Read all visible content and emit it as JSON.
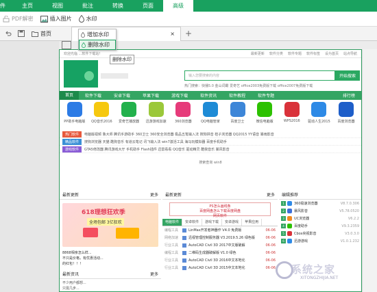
{
  "ribbon": {
    "left_label": "件",
    "tabs": [
      "主页",
      "视图",
      "批注",
      "转换",
      "页面",
      "高级"
    ],
    "active": "高级"
  },
  "toolbar": {
    "pdf_decrypt": "PDF解密",
    "insert_image": "插入图片",
    "watermark": "水印"
  },
  "tabs": {
    "home": "首页",
    "close": "×",
    "add": "+"
  },
  "popup": {
    "add_watermark": "增加水印",
    "remove_watermark": "删除水印",
    "tooltip": "删除水印"
  },
  "site": {
    "top_notice": "欢迎光临 ...软件下载站！",
    "top_links": [
      "最新更新",
      "软件分类",
      "软件专题",
      "软件标签",
      "设为首页",
      "站点导航"
    ],
    "search_placeholder": "输入您要搜索的内容",
    "search_button": "开始搜索",
    "hot_search": "热门搜索：快播5.0  金山词霸  爱奇艺  office2003免费版下载  office2007免费版下载",
    "nav": [
      "首页",
      "软件下载",
      "安卓下载",
      "苹果下载",
      "游戏下载",
      "软件资讯",
      "软件教程",
      "软件专题"
    ],
    "nav_right": "排行榜",
    "apps": [
      {
        "name": "PP助手电脑版",
        "color": "#2c7be5"
      },
      {
        "name": "QQ音乐2016",
        "color": "#f6c80f"
      },
      {
        "name": "爱奇艺播放器",
        "color": "#22b14c"
      },
      {
        "name": "迅游游戏加速",
        "color": "#9bc83a"
      },
      {
        "name": "360浏览器",
        "color": "#e63b7a"
      },
      {
        "name": "QQ电脑管家",
        "color": "#1e8bd6"
      },
      {
        "name": "百度卫士",
        "color": "#3d86d8"
      },
      {
        "name": "微信电脑版",
        "color": "#2dc100"
      },
      {
        "name": "WPS2016",
        "color": "#d9323a"
      },
      {
        "name": "驱动人生2015",
        "color": "#2e8ae6"
      },
      {
        "name": "百度浏览器",
        "color": "#1e5ec9"
      }
    ],
    "rows": [
      {
        "tag": "热门软件",
        "color": "#e7583c",
        "text": "电脑版视频  鲁大师  腾讯手游助手  360卫士  360安全浏览器  极品五笔输入法  搜狗拼音  桔子浏览器  QQ2015  YY语音  暴雨影音"
      },
      {
        "tag": "精品软件",
        "color": "#3a8fd6",
        "text": "搜狗浏览器  天猫  酷狗音乐  有道云笔记  讯飞输入法  win7激活工具  海马玩模拟器  百度手机助手"
      },
      {
        "tag": "游戏软件",
        "color": "#8a5cd6",
        "text": "GTA5修改器  腾讯游戏大厅  手机助手  Flash插件  迅雷看看  QQ音乐  驱动精灵  酷我音乐  暴风影音"
      }
    ],
    "noise_line": "搜索查询  win8",
    "left": {
      "title": "最新更新",
      "more": "更多",
      "banner_title": "618理想狂欢季",
      "banner_sub": "全场包邮 3亿狂欢",
      "text_lines": [
        "8868相亲怎么样...",
        "不只是价格，有优惠活动...",
        "的红包！！！"
      ],
      "news_title": "最新资讯",
      "news_more": "更多",
      "news_lines": [
        "不少用户都想...",
        "只需几步..."
      ]
    },
    "mid": {
      "title": "最新更新",
      "more": "更多",
      "promo_line1": "PS怎么画线条",
      "promo_line2": "百度网盘怎么下载百度网盘",
      "promo_line3": "网页软件",
      "tabs": [
        "电脑软件",
        "安卓软件",
        "游戏下载",
        "安卓游戏",
        "苹果应用"
      ],
      "items": [
        {
          "cat": "编程工具",
          "name": "LinMax开发者神器作 V4.0 免费版",
          "date": "06-06"
        },
        {
          "cat": "网络加速",
          "name": "迅视管理控制服务器 V3.2019.5.26 绿色版",
          "date": "06-06"
        },
        {
          "cat": "行业工具",
          "name": "AutoCAD Civil 3D 2017中文版破解",
          "date": "06-06"
        },
        {
          "cat": "编程工具",
          "name": "二维码生成器破解版 V1.0 绿色",
          "date": "06-06"
        },
        {
          "cat": "行业工具",
          "name": "AutoCAD Civil 3D 2016中文本地化",
          "date": "06-06"
        },
        {
          "cat": "行业工具",
          "name": "AutoCAD Civil 3D 2015中文本地化",
          "date": "06-06"
        }
      ]
    },
    "right": {
      "title": "编辑推荐",
      "items": [
        {
          "num": "1",
          "name": "360极速浏览器",
          "ver": "V8.7.0.306",
          "color": "#2f8ae6"
        },
        {
          "num": "2",
          "name": "暴风影音",
          "ver": "V5.78.0520",
          "color": "#3d6fd8"
        },
        {
          "num": "3",
          "name": "UC浏览器",
          "ver": "V6.2.2",
          "color": "#f18a21"
        },
        {
          "num": "4",
          "name": "百度助手",
          "ver": "V9.3.2359",
          "color": "#2dc100"
        },
        {
          "num": "5",
          "name": "Cbox央视影音",
          "ver": "V3.0.3.0",
          "color": "#d9323a"
        },
        {
          "num": "6",
          "name": "迅游游戏",
          "ver": "V1.0.1.232",
          "color": "#2e8ae6"
        }
      ]
    }
  },
  "watermark_text": "系统之家",
  "watermark_sub": "XITONGZHIJIA.NET"
}
